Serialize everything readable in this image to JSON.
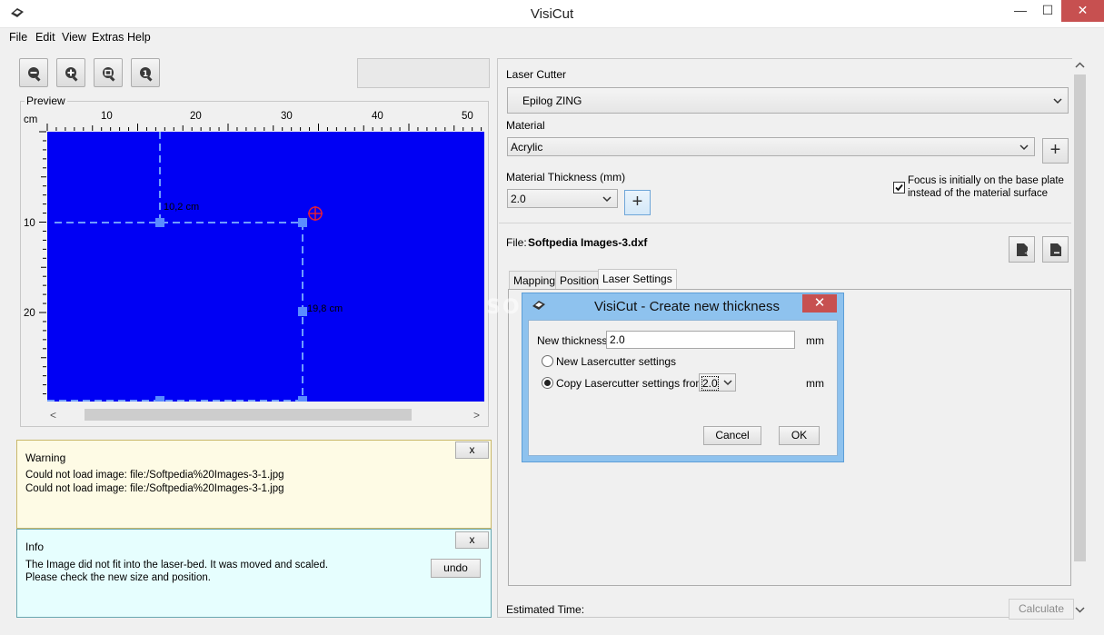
{
  "window": {
    "title": "VisiCut",
    "minimize": "—",
    "maximize": "☐",
    "close": "✕"
  },
  "menu": [
    "File",
    "Edit",
    "View",
    "Extras",
    "Help"
  ],
  "toolbar": {
    "buttons": [
      "zoom-out-icon",
      "zoom-in-icon",
      "zoom-fit-icon",
      "info-icon"
    ]
  },
  "preview": {
    "label": "Preview",
    "unit": "cm",
    "x_ticks": [
      "10",
      "20",
      "30",
      "40",
      "50"
    ],
    "y_ticks": [
      "10",
      "20"
    ],
    "width_label": "10,2 cm",
    "height_label": "19,8 cm",
    "bed_color": "#0000f4",
    "left_arrow": "<",
    "right_arrow": ">"
  },
  "warning": {
    "title": "Warning",
    "close": "x",
    "lines": [
      "Could not load image: file:/Softpedia%20Images-3-1.jpg",
      "Could not load image: file:/Softpedia%20Images-3-1.jpg"
    ],
    "bg_color": "#fefbe5"
  },
  "info": {
    "title": "Info",
    "close": "x",
    "lines": [
      "The Image did not fit into the laser-bed. It was moved and scaled.",
      "Please check the new size and position."
    ],
    "undo": "undo",
    "bg_color": "#e6fefe"
  },
  "settings": {
    "laser_cutter_label": "Laser Cutter",
    "laser_cutter_value": "Epilog ZING",
    "material_label": "Material",
    "material_value": "Acrylic",
    "thickness_label": "Material Thickness (mm)",
    "thickness_value": "2.0",
    "add": "+",
    "focus_checked": true,
    "focus_line1": "Focus is initially on the base plate",
    "focus_line2": "instead of the material surface",
    "file_label": "File:",
    "file_name": "Softpedia Images-3.dxf",
    "tabs": [
      "Mapping",
      "Position",
      "Laser Settings"
    ],
    "active_tab": "Laser Settings",
    "estimated_time_label": "Estimated Time:",
    "calculate": "Calculate"
  },
  "watermark": "SOFTPEDIA",
  "dialog": {
    "title": "VisiCut - Create new thickness",
    "close": "✕",
    "new_thickness_label": "New thickness:",
    "new_thickness_value": "2.0",
    "unit": "mm",
    "option_new": "New Lasercutter settings",
    "option_copy": "Copy Lasercutter settings from",
    "copy_from_value": "2.0",
    "selected_option": "copy",
    "cancel": "Cancel",
    "ok": "OK",
    "frame_color": "#8ec2ee"
  }
}
